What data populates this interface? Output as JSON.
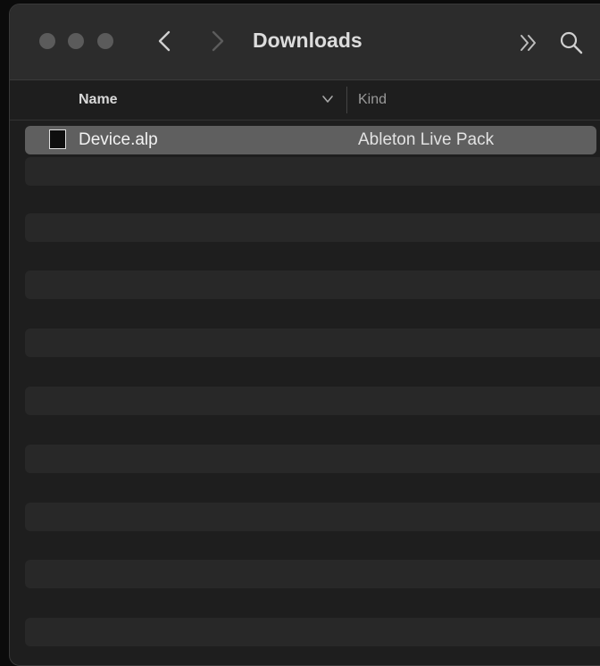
{
  "window": {
    "title": "Downloads"
  },
  "toolbar": {
    "icons": [
      "close-button",
      "minimize-button",
      "zoom-button",
      "back-icon",
      "forward-icon",
      "more-chevron-icon",
      "search-icon"
    ]
  },
  "columns": {
    "name": "Name",
    "kind": "Kind"
  },
  "files": [
    {
      "name": "Device.alp",
      "kind": "Ableton Live Pack",
      "icon": "document-icon",
      "selected": true
    }
  ],
  "colors": {
    "window_bg": "#1e1e1e",
    "titlebar_bg": "#2c2c2c",
    "stripe": "#282828",
    "selection": "#5f5f5f",
    "traffic_light": "#5b5b5b"
  }
}
